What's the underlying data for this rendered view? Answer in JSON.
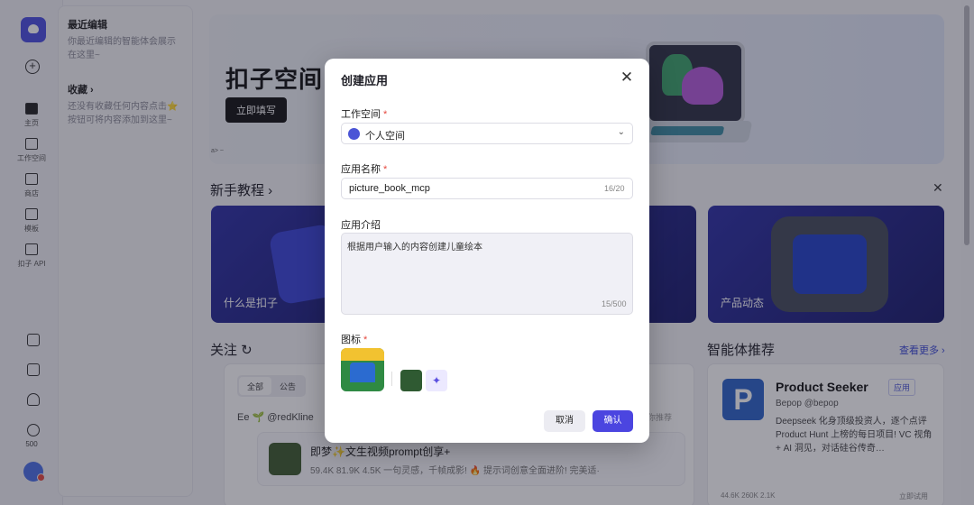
{
  "side_panel": {
    "recent_title": "最近编辑",
    "recent_desc": "你最近编辑的智能体会展示在这里~",
    "fav_title": "收藏 ›",
    "fav_desc": "还没有收藏任何内容点击⭐按钮可将内容添加到这里~"
  },
  "rail": {
    "items": [
      {
        "label": "主页",
        "icon": "home-icon"
      },
      {
        "label": "工作空间",
        "icon": "terminal-icon"
      },
      {
        "label": "商店",
        "icon": "store-icon"
      },
      {
        "label": "模板",
        "icon": "template-icon"
      },
      {
        "label": "扣子 API",
        "icon": "api-icon"
      }
    ],
    "count": "500"
  },
  "hero": {
    "title": "扣子空间",
    "button": "立即填写",
    "small": "a> ~"
  },
  "sections": {
    "tutorial": "新手教程 ›",
    "follow": "关注 ↻",
    "recommend": "智能体推荐",
    "recommend_more": "查看更多 ›"
  },
  "tutorial_cards": [
    {
      "caption": "什么是扣子"
    },
    {
      "caption": "产品动态"
    }
  ],
  "follow": {
    "chips": [
      "全部",
      "公告"
    ],
    "author_line": "Ee 🌱 @redKline",
    "post_title": "即梦✨文生视频prompt创享+",
    "post_meta": "59.4K  81.9K  4.5K  一句灵感，千帧成影! 🔥 提示词创意全面进阶! 完美适·",
    "hint": "向你推荐"
  },
  "recommend_card": {
    "icon_letter": "P",
    "name": "Product Seeker",
    "badge": "应用",
    "author": "Bepop @bepop",
    "desc": "Deepseek 化身顶级投资人，逐个点评 Product Hunt 上榜的每日项目! VC 视角 + AI 洞见，对话硅谷传奇…",
    "stats": "44.6K  260K  2.1K",
    "use": "立即试用"
  },
  "modal": {
    "title": "创建应用",
    "workspace_label": "工作空间",
    "workspace_value": "个人空间",
    "name_label": "应用名称",
    "name_value": "picture_book_mcp",
    "name_count": "16/20",
    "intro_label": "应用介绍",
    "intro_value": "根据用户输入的内容创建儿童绘本",
    "intro_count": "15/500",
    "icon_label": "图标",
    "cancel": "取消",
    "confirm": "确认"
  },
  "colors": {
    "accent": "#4b45e0",
    "required": "#e5483f"
  }
}
